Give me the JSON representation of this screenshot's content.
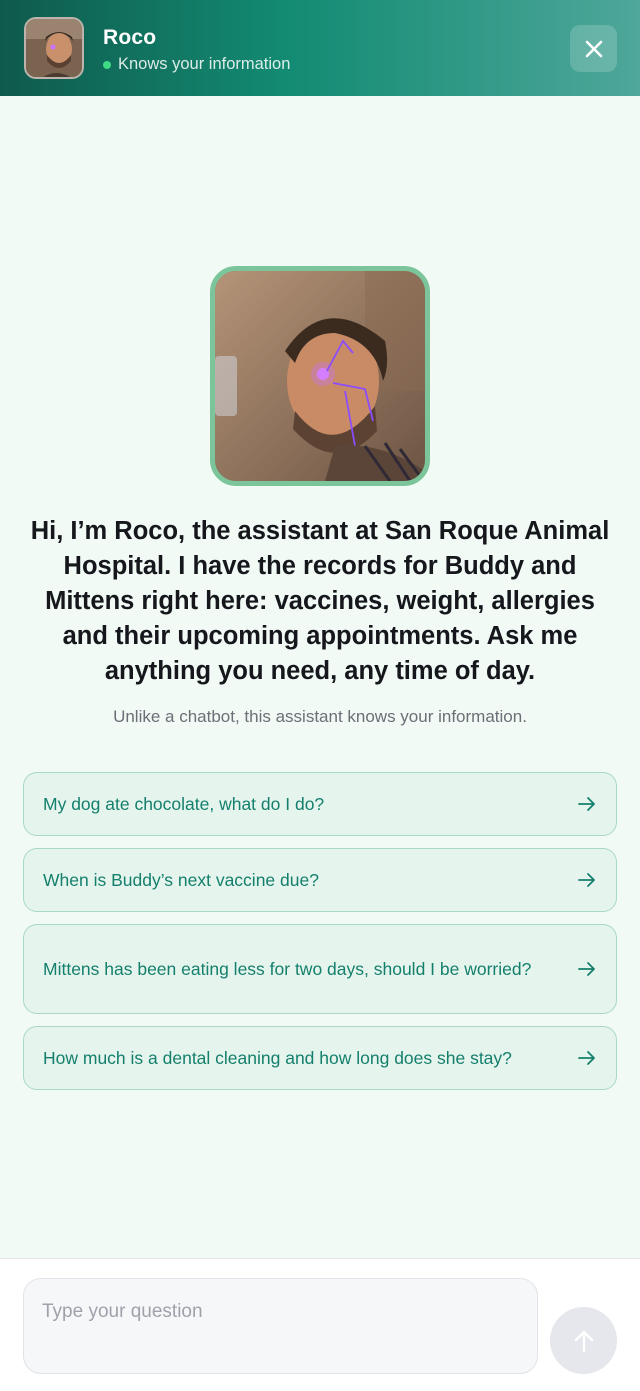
{
  "header": {
    "name": "Roco",
    "status": "Knows your information"
  },
  "intro": {
    "message": "Hi, I’m Roco, the assistant at San Roque Animal Hospital. I have the records for Buddy and Mittens right here: vaccines, weight, allergies and their upcoming appointments. Ask me anything you need, any time of day.",
    "subtext": "Unlike a chatbot, this assistant knows your information."
  },
  "suggestions": [
    {
      "label": "My dog ate chocolate, what do I do?"
    },
    {
      "label": "When is Buddy’s next vaccine due?"
    },
    {
      "label": "Mittens has been eating less for two days, should I be worried?"
    },
    {
      "label": "How much is a dental cleaning and how long does she stay?"
    }
  ],
  "composer": {
    "placeholder": "Type your question"
  },
  "icons": {
    "close": "close-icon",
    "send": "arrow-up-icon",
    "suggestion_arrow": "arrow-right-icon"
  },
  "colors": {
    "header_start": "#0f5a4c",
    "header_end": "#4ea79a",
    "accent": "#14806c",
    "status_dot": "#3ddc84",
    "avatar_border": "#7cc59a"
  }
}
